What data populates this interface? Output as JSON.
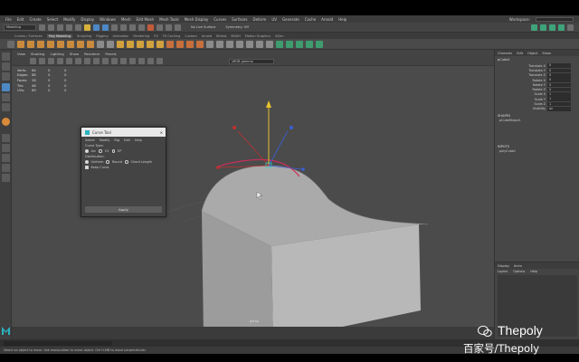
{
  "menubar": {
    "items": [
      "File",
      "Edit",
      "Create",
      "Select",
      "Modify",
      "Display",
      "Windows",
      "Mesh",
      "Edit Mesh",
      "Mesh Tools",
      "Mesh Display",
      "Curves",
      "Surfaces",
      "Deform",
      "UV",
      "Generate",
      "Cache",
      "Arnold",
      "Help"
    ],
    "workspace_label": "Workspace:"
  },
  "statusline": {
    "mode": "Modeling",
    "live_surface": "No Live Surface",
    "symmetry": "Symmetry: Off"
  },
  "shelf": {
    "tabs": [
      "Curves / Surfaces",
      "Poly Modeling",
      "Sculpting",
      "Rigging",
      "Animation",
      "Rendering",
      "FX",
      "FX Caching",
      "Custom",
      "Arnold",
      "Bifrost",
      "MASH",
      "Motion Graphics",
      "XGen"
    ],
    "active_tab": "Poly Modeling"
  },
  "viewport": {
    "menus": [
      "View",
      "Shading",
      "Lighting",
      "Show",
      "Renderer",
      "Panels"
    ],
    "camera_field": "sRGB gamma",
    "hud": {
      "rows": [
        {
          "label": "Verts:",
          "a": "64",
          "b": "0",
          "c": "0"
        },
        {
          "label": "Edges:",
          "a": "88",
          "b": "0",
          "c": "0"
        },
        {
          "label": "Faces:",
          "a": "26",
          "b": "0",
          "c": "0"
        },
        {
          "label": "Tris:",
          "a": "48",
          "b": "0",
          "c": "0"
        },
        {
          "label": "UVs:",
          "a": "89",
          "b": "0",
          "c": "0"
        }
      ]
    },
    "camera_label": "persp"
  },
  "dialog": {
    "title": "Curve Tool",
    "menus": [
      "Select",
      "Modify",
      "Rig",
      "Edit",
      "Help"
    ],
    "curve_type_label": "Curve Type:",
    "curve_types": [
      "Arc",
      "CV",
      "EP"
    ],
    "distribution_label": "Distribution:",
    "distributions": [
      "Uniform",
      "Round",
      "Chord Length"
    ],
    "option_label": "Keep Curve",
    "apply_label": "Apply"
  },
  "channelbox": {
    "tabs": [
      "Channels",
      "Edit",
      "Object",
      "Show"
    ],
    "object_name": "pCube1",
    "attributes": [
      {
        "name": "Translate X",
        "value": "0"
      },
      {
        "name": "Translate Y",
        "value": "0"
      },
      {
        "name": "Translate Z",
        "value": "0"
      },
      {
        "name": "Rotate X",
        "value": "0"
      },
      {
        "name": "Rotate Y",
        "value": "0"
      },
      {
        "name": "Rotate Z",
        "value": "0"
      },
      {
        "name": "Scale X",
        "value": "1"
      },
      {
        "name": "Scale Y",
        "value": "1"
      },
      {
        "name": "Scale Z",
        "value": "1"
      },
      {
        "name": "Visibility",
        "value": "on"
      }
    ],
    "shapes_header": "SHAPES",
    "shape_name": "pCubeShape1",
    "inputs_header": "INPUTS",
    "input_name": "polyCube1"
  },
  "layers": {
    "tabs": [
      "Display",
      "Anim"
    ],
    "menus": [
      "Layers",
      "Options",
      "Help"
    ]
  },
  "helpline": "Select an object to move. Use manipulator to move object. Ctrl+LMB to move perpendicular.",
  "watermark": {
    "name": "Thepoly",
    "sub": "百家号/Thepoly"
  },
  "colors": {
    "viewport_bg": "#4b4b4b",
    "accent": "#4d88c4"
  }
}
